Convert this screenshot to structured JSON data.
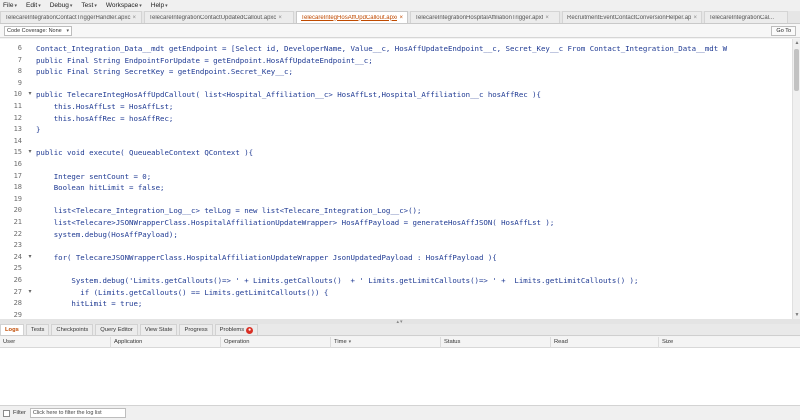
{
  "menus": [
    {
      "label": "File"
    },
    {
      "label": "Edit"
    },
    {
      "label": "Debug"
    },
    {
      "label": "Test"
    },
    {
      "label": "Workspace"
    },
    {
      "label": "Help"
    }
  ],
  "tabs": [
    {
      "label": "TelecareIntegrationContactTriggerHandler.apxc",
      "active": false
    },
    {
      "label": "TelecareIntegrationContactUpdatedCallout.apxc",
      "active": false
    },
    {
      "label": "TelecareIntegHosAffUpdCallout.apxc",
      "active": true
    },
    {
      "label": "TelecareIntegrationHospitalAffiliationTrigger.apxt",
      "active": false
    },
    {
      "label": "RecruitmentEventContactConversionHelper.apxc",
      "active": false
    },
    {
      "label": "TelecareIntegrationCal...",
      "active": false
    }
  ],
  "toolbar": {
    "coverage_label": "Code Coverage: None",
    "goto_label": "Go To"
  },
  "code_lines": [
    {
      "num": "6",
      "fold": "",
      "text": "Contact_Integration_Data__mdt getEndpoint = [Select id, DeveloperName, Value__c, HosAffUpdateEndpoint__c, Secret_Key__c From Contact_Integration_Data__mdt W"
    },
    {
      "num": "7",
      "fold": "",
      "text": "public Final String EndpointForUpdate = getEndpoint.HosAffUpdateEndpoint__c;"
    },
    {
      "num": "8",
      "fold": "",
      "text": "public Final String SecretKey = getEndpoint.Secret_Key__c;"
    },
    {
      "num": "9",
      "fold": "",
      "text": ""
    },
    {
      "num": "10",
      "fold": "▾",
      "text": "public TelecareIntegHosAffUpdCallout( list<Hospital_Affiliation__c> HosAffLst,Hospital_Affiliation__c hosAffRec ){"
    },
    {
      "num": "11",
      "fold": "",
      "text": "    this.HosAffLst = HosAffLst;"
    },
    {
      "num": "12",
      "fold": "",
      "text": "    this.hosAffRec = hosAffRec;"
    },
    {
      "num": "13",
      "fold": "",
      "text": "}"
    },
    {
      "num": "14",
      "fold": "",
      "text": ""
    },
    {
      "num": "15",
      "fold": "▾",
      "text": "public void execute( QueueableContext QContext ){"
    },
    {
      "num": "16",
      "fold": "",
      "text": ""
    },
    {
      "num": "17",
      "fold": "",
      "text": "    Integer sentCount = 0;"
    },
    {
      "num": "18",
      "fold": "",
      "text": "    Boolean hitLimit = false;"
    },
    {
      "num": "19",
      "fold": "",
      "text": ""
    },
    {
      "num": "20",
      "fold": "",
      "text": "    list<Telecare_Integration_Log__c> telLog = new list<Telecare_Integration_Log__c>();"
    },
    {
      "num": "21",
      "fold": "",
      "text": "    list<Telecare>JSONWrapperClass.HospitalAffiliationUpdateWrapper> HosAffPayload = generateHosAffJSON( HosAffLst );"
    },
    {
      "num": "22",
      "fold": "",
      "text": "    system.debug(HosAffPayload);"
    },
    {
      "num": "23",
      "fold": "",
      "text": ""
    },
    {
      "num": "24",
      "fold": "▾",
      "text": "    for( TelecareJSONWrapperClass.HospitalAffiliationUpdateWrapper JsonUpdatedPayload : HosAffPayload ){"
    },
    {
      "num": "25",
      "fold": "",
      "text": ""
    },
    {
      "num": "26",
      "fold": "",
      "text": "        System.debug('Limits.getCallouts()=> ' + Limits.getCallouts()  + ' Limits.getLimitCallouts()=> ' +  Limits.getLimitCallouts() );"
    },
    {
      "num": "27",
      "fold": "▾",
      "text": "          if (Limits.getCallouts() == Limits.getLimitCallouts()) {"
    },
    {
      "num": "28",
      "fold": "",
      "text": "        hitLimit = true;"
    },
    {
      "num": "29",
      "fold": "",
      "text": ""
    }
  ],
  "panel_tabs": [
    {
      "label": "Logs",
      "active": true
    },
    {
      "label": "Tests",
      "active": false
    },
    {
      "label": "Checkpoints",
      "active": false
    },
    {
      "label": "Query Editor",
      "active": false
    },
    {
      "label": "View State",
      "active": false
    },
    {
      "label": "Progress",
      "active": false
    },
    {
      "label": "Problems",
      "active": false
    }
  ],
  "log_columns": [
    {
      "label": "User"
    },
    {
      "label": "Application"
    },
    {
      "label": "Operation"
    },
    {
      "label": "Time"
    },
    {
      "label": "Status"
    },
    {
      "label": "Read"
    },
    {
      "label": "Size"
    }
  ],
  "filter": {
    "label": "Filter",
    "placeholder": "Click here to filter the log list"
  },
  "colors": {
    "active_tab": "#c04a00",
    "code_text": "#1f3a93",
    "error_badge": "#d93025"
  }
}
